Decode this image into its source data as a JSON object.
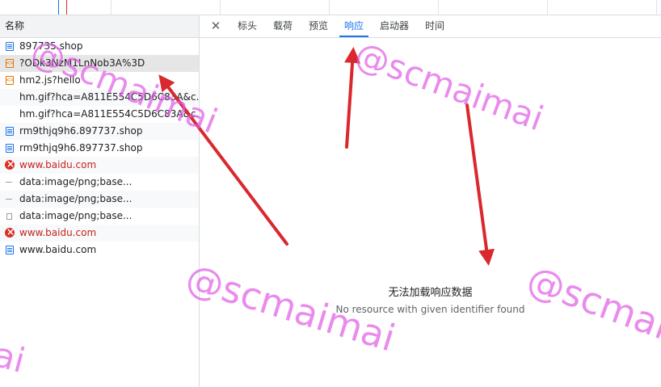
{
  "left_panel": {
    "column_header": "名称",
    "requests": [
      {
        "name": "897735.shop",
        "icon": "document-icon",
        "status": "normal"
      },
      {
        "name": "?ODk3NzM1LnNob3A%3D",
        "icon": "script-icon",
        "status": "selected"
      },
      {
        "name": "hm2.js?hello",
        "icon": "script-icon",
        "status": "normal"
      },
      {
        "name": "hm.gif?hca=A811E554C5D6C83A&c...",
        "icon": "",
        "status": "normal"
      },
      {
        "name": "hm.gif?hca=A811E554C5D6C83A&c...",
        "icon": "",
        "status": "normal"
      },
      {
        "name": "rm9thjq9h6.897737.shop",
        "icon": "document-icon",
        "status": "normal"
      },
      {
        "name": "rm9thjq9h6.897737.shop",
        "icon": "document-icon",
        "status": "normal"
      },
      {
        "name": "www.baidu.com",
        "icon": "error-icon",
        "status": "error"
      },
      {
        "name": "data:image/png;base...",
        "icon": "dash-icon",
        "status": "normal"
      },
      {
        "name": "data:image/png;base...",
        "icon": "dash-icon",
        "status": "normal"
      },
      {
        "name": "data:image/png;base...",
        "icon": "file-icon",
        "status": "normal"
      },
      {
        "name": "www.baidu.com",
        "icon": "error-icon",
        "status": "error"
      },
      {
        "name": "www.baidu.com",
        "icon": "document-icon",
        "status": "normal"
      }
    ]
  },
  "detail_panel": {
    "close_icon": "close-icon",
    "tabs": [
      {
        "label": "标头"
      },
      {
        "label": "载荷"
      },
      {
        "label": "预览"
      },
      {
        "label": "响应",
        "active": true
      },
      {
        "label": "启动器"
      },
      {
        "label": "时间"
      }
    ],
    "empty_title": "无法加载响应数据",
    "empty_desc": "No resource with given identifier found"
  },
  "watermark": {
    "text": "@scmaimai",
    "text_partial": "ai"
  },
  "colors": {
    "accent": "#1a73e8",
    "error": "#d93025",
    "annotation_arrow": "#d9282e",
    "watermark": "#e05ae6"
  }
}
